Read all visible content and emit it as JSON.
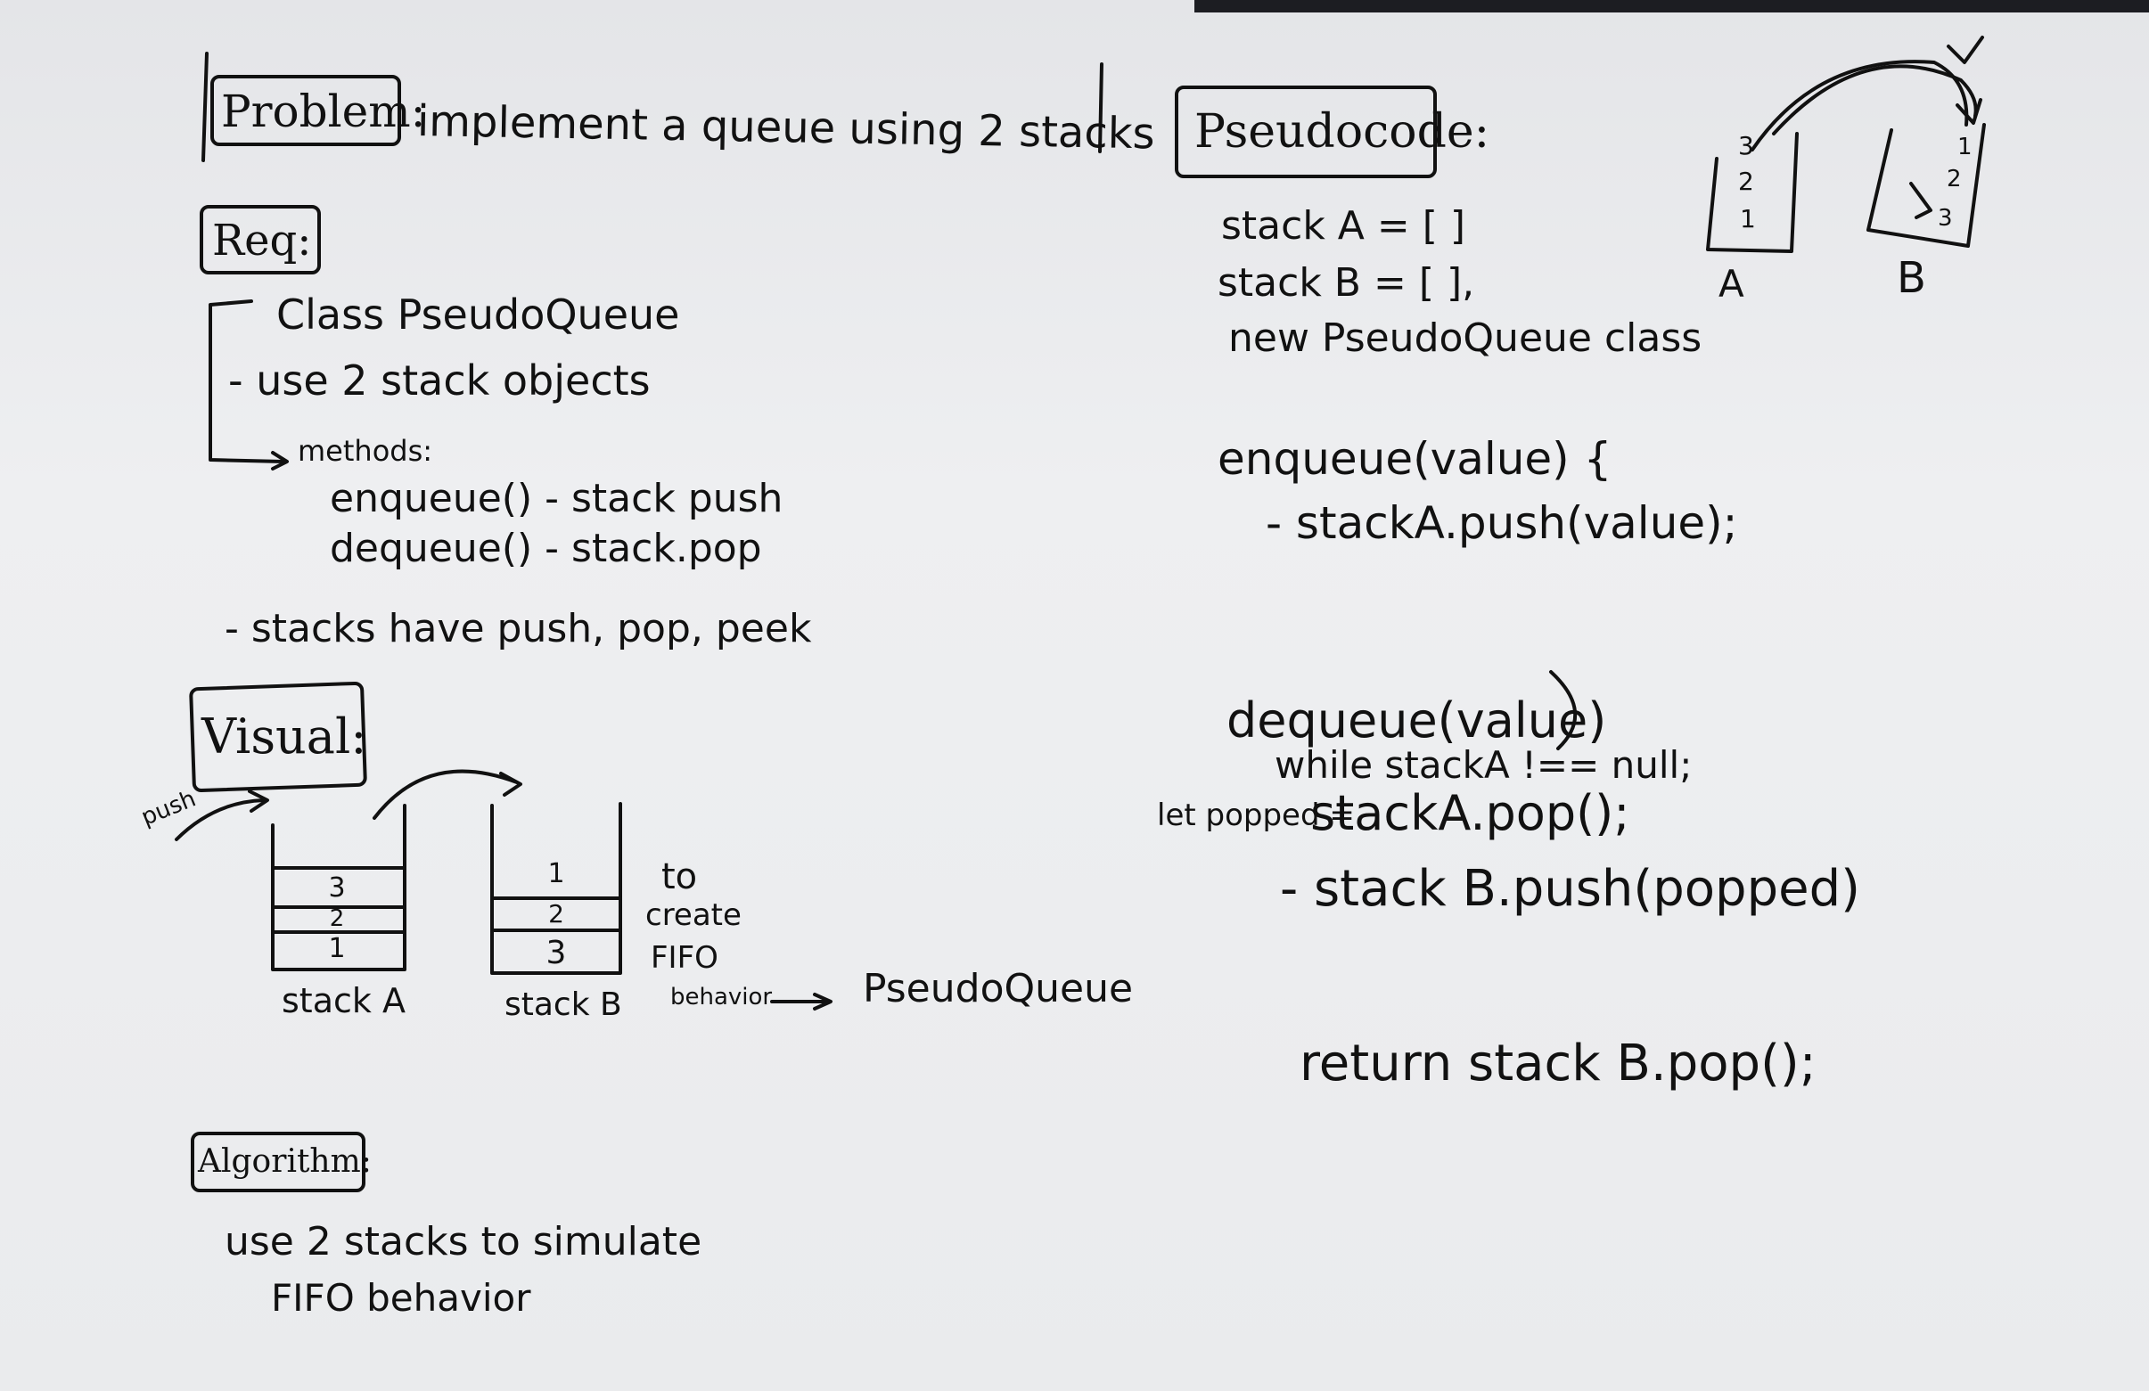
{
  "problem": {
    "heading": "Problem:",
    "text": "implement a queue using 2 stacks"
  },
  "requirements": {
    "heading": "Req:",
    "class_line": "Class PseudoQueue",
    "stacks_line": "- use 2 stack objects",
    "methods_heading": "methods:",
    "enqueue_line": "enqueue() - stack push",
    "dequeue_line": "dequeue() - stack.pop",
    "note": "- stacks have push, pop, peek"
  },
  "visual": {
    "heading": "Visual:",
    "push_label": "push",
    "stack_a": {
      "label": "stack A",
      "items": [
        "3",
        "2",
        "1"
      ]
    },
    "stack_b": {
      "label": "stack B",
      "items": [
        "1",
        "2",
        "3"
      ]
    },
    "caption_lines": [
      "to",
      "create",
      "FIFO",
      "behavior"
    ],
    "result": "PseudoQueue"
  },
  "algorithm": {
    "heading": "Algorithm:",
    "line1": "use 2 stacks to simulate",
    "line2": "FIFO behavior"
  },
  "pseudocode": {
    "heading": "Pseudocode:",
    "lines": {
      "stack_a": "stack A = [        ]",
      "stack_b": "stack B = [ ],",
      "new_class": "new PseudoQueue class",
      "enqueue_sig": "enqueue(value) {",
      "enqueue_body": "- stackA.push(value);",
      "dequeue_sig": "dequeue(value)",
      "while_line": "while stackA !== null;",
      "let_prefix": "let popped =",
      "pop_line": "stackA.pop();",
      "push_b": "- stack B.push(popped)",
      "return_line": "return stack B.pop();"
    }
  },
  "corner_sketch": {
    "stack_a_label": "A",
    "stack_b_label": "B",
    "stack_a_items": [
      "3",
      "2",
      "1"
    ],
    "stack_b_items": [
      "1",
      "2",
      "3"
    ]
  }
}
